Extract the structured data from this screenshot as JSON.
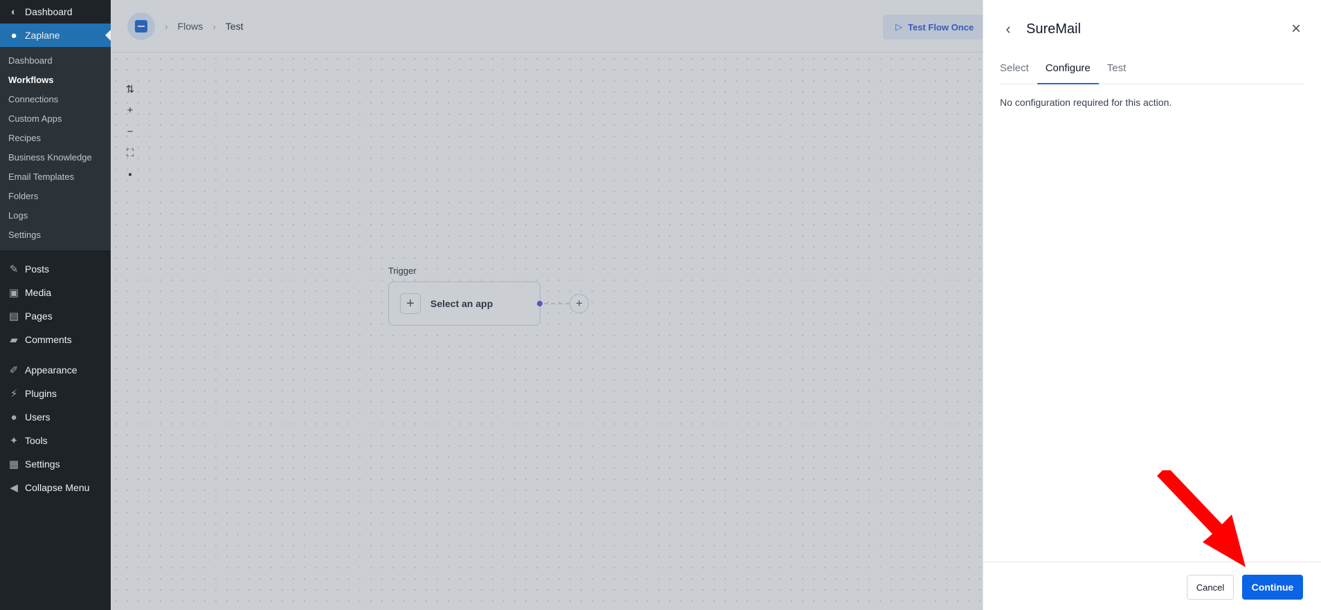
{
  "wp_menu": {
    "dashboard": "Dashboard",
    "zaplane": "Zaplane",
    "submenu": [
      "Dashboard",
      "Workflows",
      "Connections",
      "Custom Apps",
      "Recipes",
      "Business Knowledge",
      "Email Templates",
      "Folders",
      "Logs",
      "Settings"
    ],
    "current_submenu": "Workflows",
    "group2": [
      "Posts",
      "Media",
      "Pages",
      "Comments"
    ],
    "group3": [
      "Appearance",
      "Plugins",
      "Users",
      "Tools",
      "Settings",
      "Collapse Menu"
    ]
  },
  "topbar": {
    "breadcrumb_1": "Flows",
    "breadcrumb_2": "Test",
    "test_flow_label": "Test Flow Once"
  },
  "canvas": {
    "trigger_label": "Trigger",
    "trigger_node_label": "Select an app"
  },
  "panel": {
    "title": "SureMail",
    "tabs": [
      "Select",
      "Configure",
      "Test"
    ],
    "active_tab": "Configure",
    "message": "No configuration required for this action.",
    "cancel_label": "Cancel",
    "continue_label": "Continue"
  },
  "colors": {
    "accent": "#0b63e5",
    "wp_active": "#2271b1",
    "annotation_arrow": "#ff0000"
  }
}
